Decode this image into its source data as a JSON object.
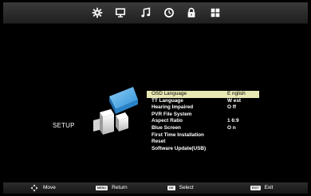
{
  "top_menu": {
    "icons": [
      "picture-settings-gear-icon",
      "monitor-icon",
      "music-note-icon",
      "timer-clock-icon",
      "lock-icon",
      "setup-grid-icon"
    ],
    "selected": "setup-grid-icon"
  },
  "section": {
    "title": "SETUP"
  },
  "menu_items": [
    {
      "label": "OSD Language",
      "value": "E nglish"
    },
    {
      "label": "TT Language",
      "value": "W est"
    },
    {
      "label": "Hearing Impaired",
      "value": "O ff"
    },
    {
      "label": "PVR File System",
      "value": ""
    },
    {
      "label": "Aspect Ratio",
      "value": "1 6:9"
    },
    {
      "label": "Blue Screen",
      "value": "O n"
    },
    {
      "label": "First Time Installation",
      "value": ""
    },
    {
      "label": "Reset",
      "value": ""
    },
    {
      "label": "Software Update(USB)",
      "value": ""
    }
  ],
  "selected_index": 0,
  "bottom_hints": {
    "move": "Move",
    "menu_key": "MENU",
    "return": "Return",
    "ok_key": "OK",
    "select": "Select",
    "exit_key": "EXIT",
    "exit": "Exit"
  },
  "colors": {
    "highlight": "#e7e7b4",
    "background": "#000000",
    "bar": "#2a2a2a"
  }
}
